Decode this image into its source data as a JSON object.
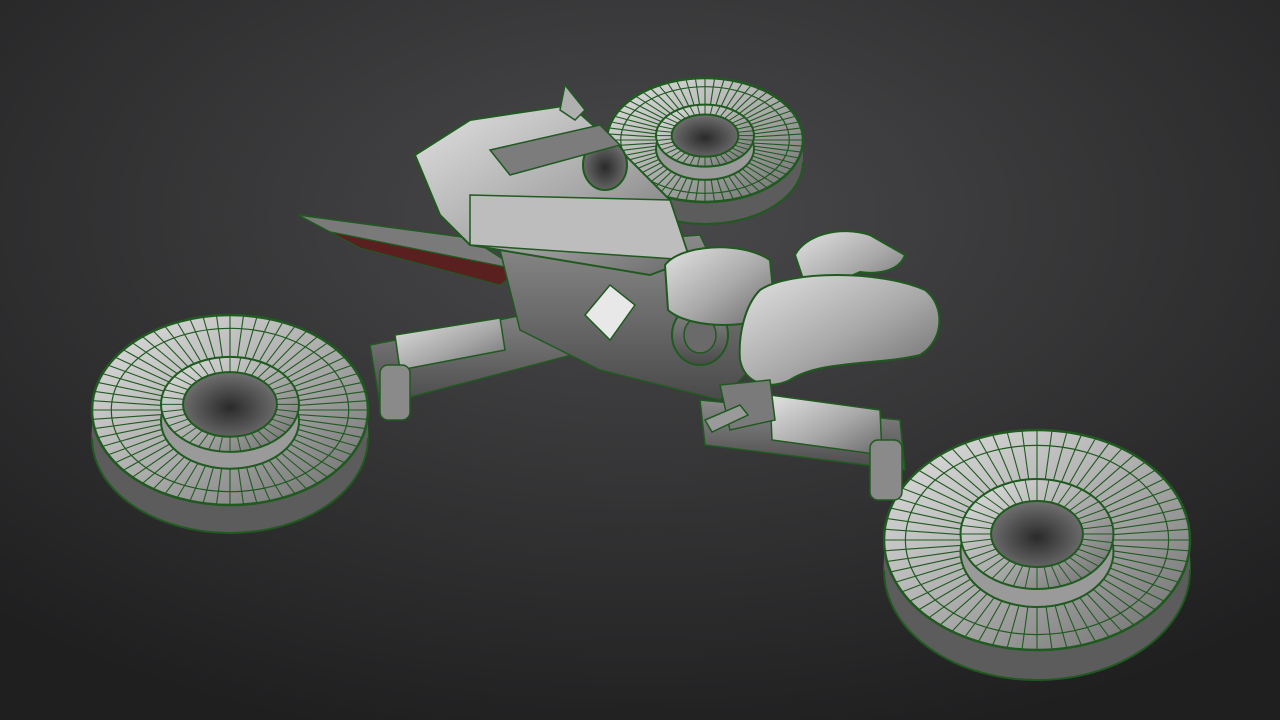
{
  "scene": {
    "subject": "hover-bike",
    "colors": {
      "bg_center": "#4a4a4c",
      "bg_edge": "#1f1f20",
      "surface_light": "#d8d8d8",
      "surface_mid": "#9a9a9a",
      "surface_dark": "#5c5c5c",
      "wire": "#1f5a1f",
      "wire_bright": "#2f8a2f",
      "accent_red": "#5a2020"
    }
  }
}
